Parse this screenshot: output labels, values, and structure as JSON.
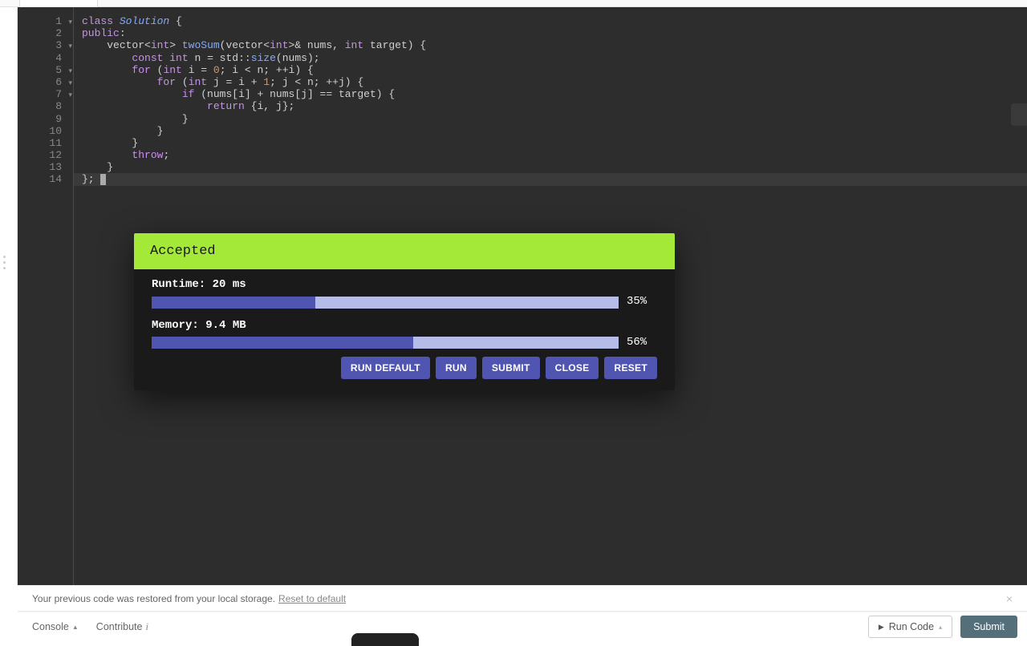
{
  "code": {
    "lines": [
      {
        "n": 1,
        "fold": true,
        "tokens": [
          [
            "kw",
            "class "
          ],
          [
            "cls",
            "Solution"
          ],
          [
            "op",
            " {"
          ]
        ]
      },
      {
        "n": 2,
        "fold": false,
        "tokens": [
          [
            "pub",
            "public"
          ],
          [
            "op",
            ":"
          ]
        ]
      },
      {
        "n": 3,
        "fold": true,
        "tokens": [
          [
            "op",
            "    "
          ],
          [
            "id",
            "vector"
          ],
          [
            "op",
            "<"
          ],
          [
            "kw",
            "int"
          ],
          [
            "op",
            "> "
          ],
          [
            "fn",
            "twoSum"
          ],
          [
            "op",
            "("
          ],
          [
            "id",
            "vector"
          ],
          [
            "op",
            "<"
          ],
          [
            "kw",
            "int"
          ],
          [
            "op",
            ">& "
          ],
          [
            "id",
            "nums"
          ],
          [
            "op",
            ", "
          ],
          [
            "kw",
            "int"
          ],
          [
            "op",
            " "
          ],
          [
            "id",
            "target"
          ],
          [
            "op",
            ") {"
          ]
        ]
      },
      {
        "n": 4,
        "fold": false,
        "tokens": [
          [
            "op",
            "        "
          ],
          [
            "const",
            "const "
          ],
          [
            "kw",
            "int"
          ],
          [
            "op",
            " "
          ],
          [
            "id",
            "n"
          ],
          [
            "op",
            " = "
          ],
          [
            "id",
            "std"
          ],
          [
            "op",
            "::"
          ],
          [
            "fn",
            "size"
          ],
          [
            "op",
            "("
          ],
          [
            "id",
            "nums"
          ],
          [
            "op",
            ");"
          ]
        ]
      },
      {
        "n": 5,
        "fold": true,
        "tokens": [
          [
            "op",
            "        "
          ],
          [
            "for",
            "for"
          ],
          [
            "op",
            " ("
          ],
          [
            "kw",
            "int"
          ],
          [
            "op",
            " "
          ],
          [
            "id",
            "i"
          ],
          [
            "op",
            " = "
          ],
          [
            "num",
            "0"
          ],
          [
            "op",
            "; "
          ],
          [
            "id",
            "i"
          ],
          [
            "op",
            " < "
          ],
          [
            "id",
            "n"
          ],
          [
            "op",
            "; ++"
          ],
          [
            "id",
            "i"
          ],
          [
            "op",
            ") {"
          ]
        ]
      },
      {
        "n": 6,
        "fold": true,
        "tokens": [
          [
            "op",
            "            "
          ],
          [
            "for",
            "for"
          ],
          [
            "op",
            " ("
          ],
          [
            "kw",
            "int"
          ],
          [
            "op",
            " "
          ],
          [
            "id",
            "j"
          ],
          [
            "op",
            " = "
          ],
          [
            "id",
            "i"
          ],
          [
            "op",
            " + "
          ],
          [
            "num",
            "1"
          ],
          [
            "op",
            "; "
          ],
          [
            "id",
            "j"
          ],
          [
            "op",
            " < "
          ],
          [
            "id",
            "n"
          ],
          [
            "op",
            "; ++"
          ],
          [
            "id",
            "j"
          ],
          [
            "op",
            ") {"
          ]
        ]
      },
      {
        "n": 7,
        "fold": true,
        "tokens": [
          [
            "op",
            "                "
          ],
          [
            "for",
            "if"
          ],
          [
            "op",
            " ("
          ],
          [
            "id",
            "nums"
          ],
          [
            "op",
            "["
          ],
          [
            "id",
            "i"
          ],
          [
            "op",
            "] + "
          ],
          [
            "id",
            "nums"
          ],
          [
            "op",
            "["
          ],
          [
            "id",
            "j"
          ],
          [
            "op",
            "] == "
          ],
          [
            "id",
            "target"
          ],
          [
            "op",
            ") {"
          ]
        ]
      },
      {
        "n": 8,
        "fold": false,
        "tokens": [
          [
            "op",
            "                    "
          ],
          [
            "ret",
            "return"
          ],
          [
            "op",
            " {"
          ],
          [
            "id",
            "i"
          ],
          [
            "op",
            ", "
          ],
          [
            "id",
            "j"
          ],
          [
            "op",
            "};"
          ]
        ]
      },
      {
        "n": 9,
        "fold": false,
        "tokens": [
          [
            "op",
            "                }"
          ]
        ]
      },
      {
        "n": 10,
        "fold": false,
        "tokens": [
          [
            "op",
            "            }"
          ]
        ]
      },
      {
        "n": 11,
        "fold": false,
        "tokens": [
          [
            "op",
            "        }"
          ]
        ]
      },
      {
        "n": 12,
        "fold": false,
        "tokens": [
          [
            "op",
            "        "
          ],
          [
            "throw",
            "throw"
          ],
          [
            "op",
            ";"
          ]
        ]
      },
      {
        "n": 13,
        "fold": false,
        "tokens": [
          [
            "op",
            "    }"
          ]
        ]
      },
      {
        "n": 14,
        "fold": false,
        "current": true,
        "tokens": [
          [
            "op",
            "}; "
          ]
        ]
      }
    ]
  },
  "result": {
    "status": "Accepted",
    "runtime_label": "Runtime: 20 ms",
    "runtime_pct_text": "35%",
    "runtime_pct": 35,
    "memory_label": "Memory: 9.4 MB",
    "memory_pct_text": "56%",
    "memory_pct": 56,
    "buttons": {
      "run_default": "RUN DEFAULT",
      "run": "RUN",
      "submit": "SUBMIT",
      "close": "CLOSE",
      "reset": "RESET"
    }
  },
  "restore": {
    "message": "Your previous code was restored from your local storage.",
    "reset_link": "Reset to default"
  },
  "footer": {
    "console": "Console",
    "contribute": "Contribute",
    "run_code": "Run Code",
    "submit": "Submit"
  }
}
